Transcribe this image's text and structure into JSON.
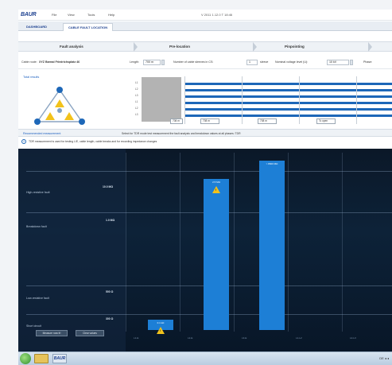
{
  "app": {
    "logo": "BAUR",
    "menu": [
      "File",
      "View",
      "Tools",
      "Help"
    ],
    "status": "V 2011   1.12.0   T 18:46"
  },
  "tabs": [
    {
      "label": "DASHBOARD",
      "active": false
    },
    {
      "label": "CABLE FAULT LOCATION",
      "active": true
    }
  ],
  "steps": [
    {
      "label": "Fault analysis"
    },
    {
      "label": "Pre-location"
    },
    {
      "label": "Pinpointing"
    }
  ],
  "params": {
    "cable_route_label": "Cable route:",
    "cable_route_value": "XYZ Barrad Friedrichsplatz 46",
    "length_label": "Length:",
    "length_value": "700 m",
    "sleeves_label": "Number of cable sleeves in CS:",
    "sleeves_value": "1",
    "sleeves_unit": "sleeve",
    "voltage_label": "Nominal voltage level (U):",
    "voltage_value": "10 kV",
    "phase_label": "Phase:"
  },
  "results": {
    "label": "Total results",
    "track_labels": [
      "L1",
      "L2",
      "L3",
      "L1",
      "L2",
      "L3"
    ],
    "value_boxes": [
      "708 m",
      "708 m",
      "708 m",
      "Tc open"
    ]
  },
  "recommendation": {
    "label": "Recommended measurement",
    "text": "Select for TDR mode test measurement the fault analysis and breakdown values at all phases: TDR"
  },
  "info": {
    "icon": "i",
    "text": "TDR measurement is used for testing L/E, cable length, cable breaks and for recording impedance changes"
  },
  "chart_data": {
    "type": "bar",
    "zones": [
      {
        "label": "High-resistive fault"
      },
      {
        "label": "Breakdown fault"
      },
      {
        "label": "Low-resistive fault"
      },
      {
        "label": "Short circuit"
      }
    ],
    "y_ticks": [
      "10.0 MΩ",
      "1.0 MΩ",
      "500 Ω",
      "300 Ω"
    ],
    "bars": [
      {
        "label": "L1-E",
        "value": 120
      },
      {
        "label": "L2-E",
        "value": 2500000
      },
      {
        "label": "L3-E",
        "value": 8600000
      }
    ],
    "bar_top_labels": [
      "0.1 kΩ",
      "2.5 MΩ",
      "> 8600 MΩ"
    ],
    "x_ticks": [
      "L1-E",
      "L2-E",
      "L3-E",
      "L1-L2",
      "L2-L3"
    ],
    "buttons": [
      "Measure now fri",
      "Clear values"
    ],
    "warning_marker": "!"
  },
  "taskbar": {
    "app": "BAUR",
    "tray": "DE  ◂  ◂"
  }
}
